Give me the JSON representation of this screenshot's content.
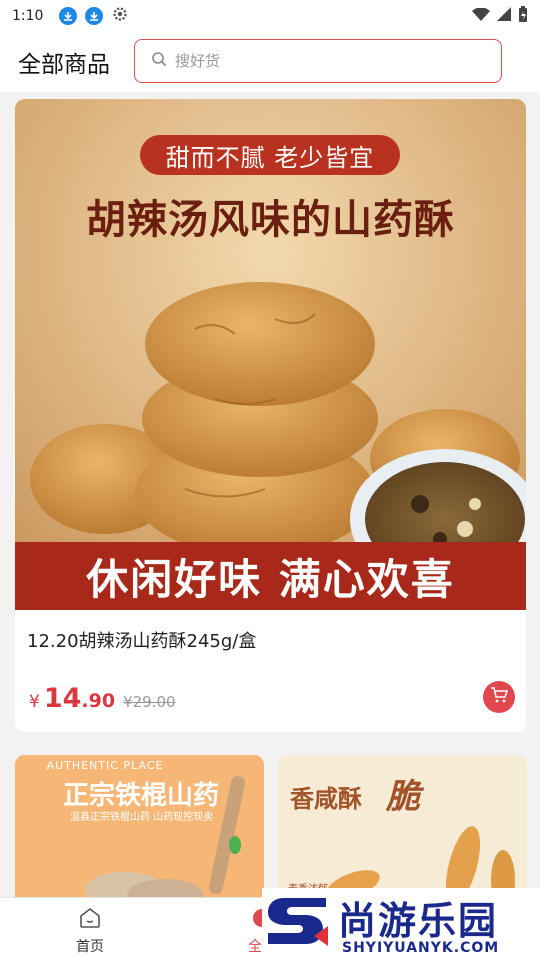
{
  "status_bar": {
    "time": "1:10"
  },
  "header": {
    "title": "全部商品",
    "search_placeholder": "搜好货"
  },
  "featured": {
    "banner_tag": "甜而不腻 老少皆宜",
    "banner_title": "胡辣汤风味的山药酥",
    "banner_bottom": "休闲好味 满心欢喜",
    "name": "12.20胡辣汤山药酥245g/盒",
    "price_currency": "¥",
    "price_int": "14",
    "price_dec": ".90",
    "old_price": "¥29.00"
  },
  "mini_cards": [
    {
      "eng": "AUTHENTIC PLACE",
      "title": "正宗铁棍山药",
      "sub": "温县正宗铁棍山药 山药现挖现卖"
    },
    {
      "title": "香咸酥",
      "crisp": "脆",
      "small": "麦香浓郁"
    }
  ],
  "tabbar": {
    "home": "首页",
    "all": "全部"
  },
  "watermark": {
    "cn": "尚游乐园",
    "en": "SHYIYUANYK.COM"
  },
  "colors": {
    "accent": "#e0484e",
    "banner_red": "#a8281a",
    "brand_blue": "#1a2a8c"
  }
}
